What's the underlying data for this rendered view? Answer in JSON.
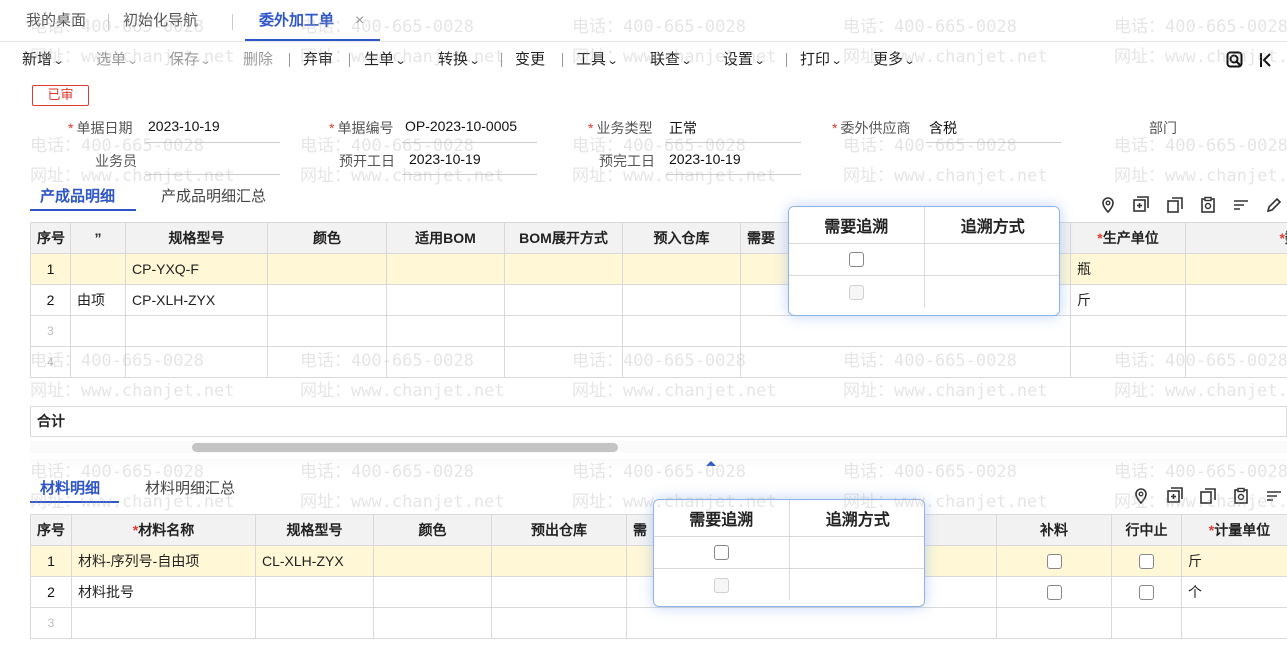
{
  "tabs": [
    {
      "label": "我的桌面"
    },
    {
      "label": "初始化导航"
    },
    {
      "label": "委外加工单",
      "close": "×"
    }
  ],
  "toolbar": {
    "new": "新增",
    "pick": "选单",
    "save": "保存",
    "delete": "删除",
    "unaudit": "弃审",
    "generate": "生单",
    "convert": "转换",
    "change": "变更",
    "tools": "工具",
    "query": "联查",
    "settings": "设置",
    "print": "打印",
    "more": "更多"
  },
  "status_badge": "已审",
  "form": {
    "date": {
      "label": "单据日期",
      "value": "2023-10-19"
    },
    "number": {
      "label": "单据编号",
      "value": "OP-2023-10-0005"
    },
    "biztype": {
      "label": "业务类型",
      "value": "正常"
    },
    "supplier": {
      "label": "委外供应商",
      "value": "含税"
    },
    "dept": {
      "label": "部门",
      "value": ""
    },
    "clerk": {
      "label": "业务员",
      "value": ""
    },
    "plan_start": {
      "label": "预开工日",
      "value": "2023-10-19"
    },
    "plan_end": {
      "label": "预完工日",
      "value": "2023-10-19"
    }
  },
  "product": {
    "tab_active": "产成品明细",
    "tab_other": "产成品明细汇总",
    "headers": {
      "idx": "序号",
      "c1": "”",
      "spec": "规格型号",
      "color": "颜色",
      "bom": "适用BOM",
      "bommode": "BOM展开方式",
      "warehouse": "预入仓库",
      "need": "需要",
      "unit": "生产单位",
      "qty": "数"
    },
    "rows": [
      {
        "idx": "1",
        "c1": "",
        "spec": "CP-YXQ-F",
        "unit": "瓶"
      },
      {
        "idx": "2",
        "c1": "由项",
        "spec": "CP-XLH-ZYX",
        "unit": "斤"
      },
      {
        "idx": "3"
      },
      {
        "idx": "4"
      }
    ],
    "total_label": "合计",
    "popup": {
      "h1": "需要追溯",
      "h2": "追溯方式"
    }
  },
  "material": {
    "tab_active": "材料明细",
    "tab_other": "材料明细汇总",
    "headers": {
      "idx": "序号",
      "name": "材料名称",
      "spec": "规格型号",
      "color": "颜色",
      "warehouse": "预出仓库",
      "need": "需",
      "supplement": "补料",
      "stop": "行中止",
      "unit": "计量单位"
    },
    "rows": [
      {
        "idx": "1",
        "name": "材料-序列号-自由项",
        "spec": "CL-XLH-ZYX",
        "unit": "斤"
      },
      {
        "idx": "2",
        "name": "材料批号",
        "spec": "",
        "unit": "个"
      },
      {
        "idx": "3"
      }
    ],
    "popup": {
      "h1": "需要追溯",
      "h2": "追溯方式"
    }
  },
  "watermark": {
    "phone": "电话：400-665-0028",
    "site": "网址：www.chanjet.net"
  },
  "colors": {
    "accent": "#2f56c9",
    "required": "#e23a2e",
    "selected_row": "#fff7d6"
  }
}
